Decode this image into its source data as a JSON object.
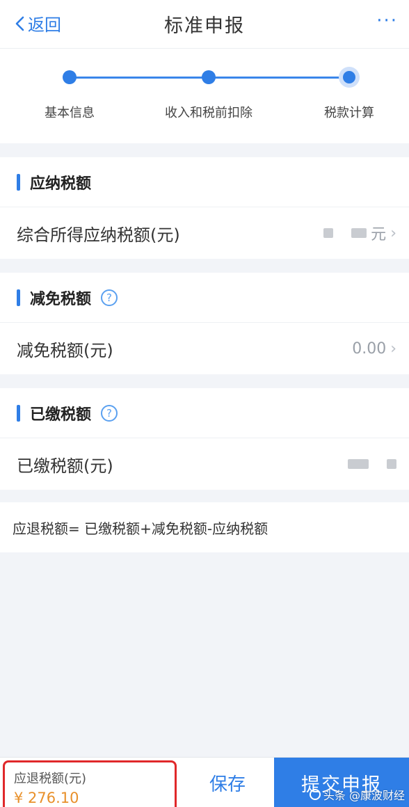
{
  "header": {
    "back_label": "返回",
    "title": "标准申报",
    "more_label": "···"
  },
  "steps": [
    {
      "label": "基本信息",
      "state": "done"
    },
    {
      "label": "收入和税前扣除",
      "state": "done"
    },
    {
      "label": "税款计算",
      "state": "active"
    }
  ],
  "sections": {
    "payable": {
      "title": "应纳税额",
      "row_label": "综合所得应纳税额(元)",
      "row_value_suffix": "元"
    },
    "reduction": {
      "title": "减免税额",
      "row_label": "减免税额(元)",
      "row_value": "0.00"
    },
    "paid": {
      "title": "已缴税额",
      "row_label": "已缴税额(元)"
    }
  },
  "formula": "应退税额= 已缴税额+减免税额-应纳税额",
  "footer": {
    "refund_label": "应退税额(元)",
    "refund_amount": "¥ 276.10",
    "save_label": "保存",
    "submit_label": "提交申报"
  },
  "watermark": "头条 @康波财经",
  "colors": {
    "accent": "#2f7ee6",
    "refund_amount": "#e8902a",
    "highlight_border": "#e0282a"
  }
}
